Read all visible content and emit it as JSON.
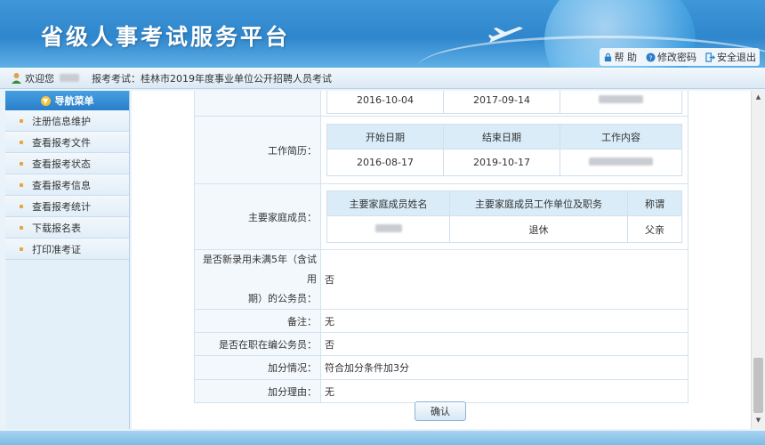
{
  "header": {
    "title": "省级人事考试服务平台",
    "links": [
      {
        "label": "帮 助",
        "icon": "help-lock-icon"
      },
      {
        "label": "修改密码",
        "icon": "question-icon"
      },
      {
        "label": "安全退出",
        "icon": "exit-icon"
      }
    ]
  },
  "welcome": {
    "greeting": "欢迎您",
    "exam_label": "报考考试：桂林市2019年度事业单位公开招聘人员考试"
  },
  "sidebar": {
    "title": "导航菜单",
    "items": [
      {
        "label": "注册信息维护"
      },
      {
        "label": "查看报考文件"
      },
      {
        "label": "查看报考状态"
      },
      {
        "label": "查看报考信息"
      },
      {
        "label": "查看报考统计"
      },
      {
        "label": "下载报名表"
      },
      {
        "label": "打印准考证"
      }
    ]
  },
  "form": {
    "prev_row": {
      "start": "2016-10-04",
      "end": "2017-09-14"
    },
    "work_history": {
      "label": "工作简历：",
      "headers": [
        "开始日期",
        "结束日期",
        "工作内容"
      ],
      "rows": [
        {
          "start": "2016-08-17",
          "end": "2019-10-17"
        }
      ]
    },
    "family": {
      "label": "主要家庭成员：",
      "headers": [
        "主要家庭成员姓名",
        "主要家庭成员工作单位及职务",
        "称谓"
      ],
      "rows": [
        {
          "unit": "退休",
          "relation": "父亲"
        }
      ]
    },
    "fields": [
      {
        "label_line1": "是否新录用未满5年（含试用",
        "label_line2": "期）的公务员：",
        "value": "否"
      },
      {
        "label": "备注：",
        "value": "无"
      },
      {
        "label": "是否在职在编公务员：",
        "value": "否"
      },
      {
        "label": "加分情况：",
        "value": "符合加分条件加3分"
      },
      {
        "label": "加分理由：",
        "value": "无"
      }
    ]
  },
  "buttons": {
    "confirm": "确认"
  },
  "colors": {
    "header_blue": "#2f86cc",
    "nav_blue": "#2a7fc8",
    "table_header": "#d9ecf8",
    "label_bg": "#f3f8fc"
  }
}
